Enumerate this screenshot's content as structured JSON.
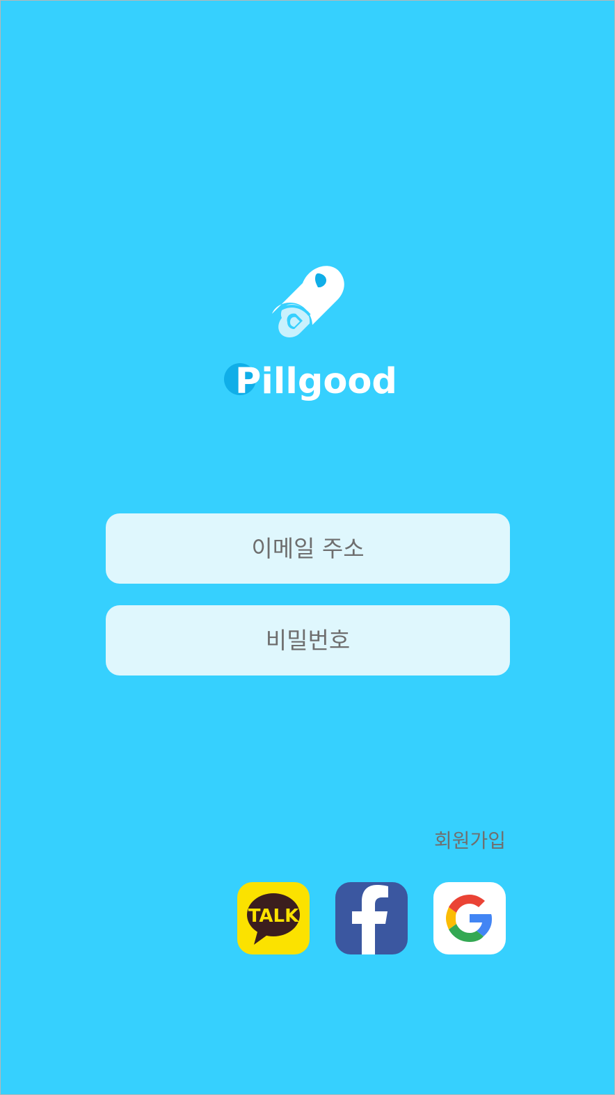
{
  "app": {
    "name": "Pillgood"
  },
  "logo": {
    "wordmark_initial": "P",
    "wordmark_rest": "illgood",
    "icon": "pill-capsule-icon"
  },
  "login": {
    "email_placeholder": "이메일 주소",
    "password_placeholder": "비밀번호",
    "signup_label": "회원가입"
  },
  "social": [
    {
      "name": "kakao",
      "label": "TALK",
      "icon": "kakaotalk-icon"
    },
    {
      "name": "facebook",
      "label": "f",
      "icon": "facebook-icon"
    },
    {
      "name": "google",
      "label": "G",
      "icon": "google-icon"
    }
  ],
  "colors": {
    "background": "#36d0fe",
    "field_background": "#dff7fd",
    "placeholder_text": "#6e6e6e",
    "logo_accent": "#10aee8",
    "kakao_yellow": "#fbe200",
    "kakao_brown": "#3b1e1e",
    "facebook_blue": "#3b57a0"
  }
}
